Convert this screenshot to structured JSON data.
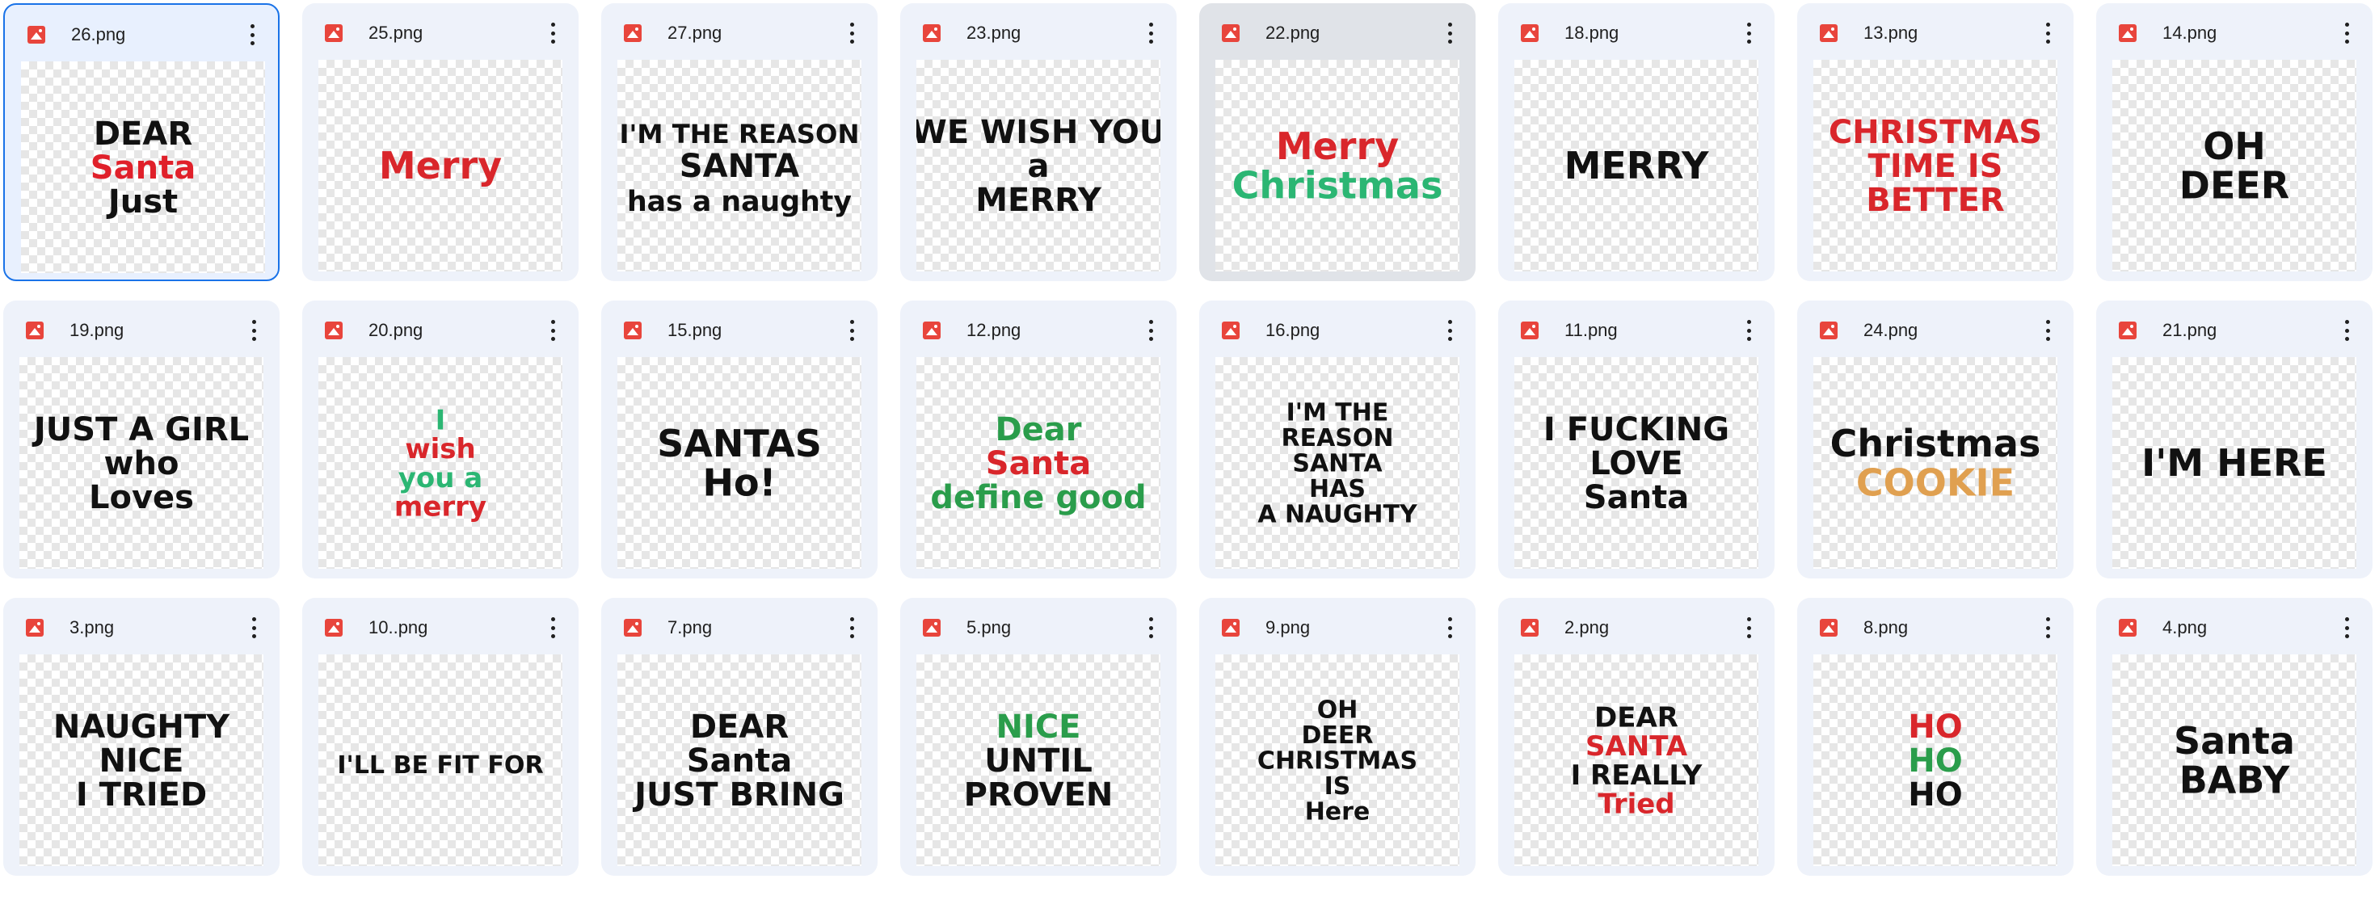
{
  "files": [
    {
      "name": "26.png",
      "selected": true,
      "hovered": false,
      "lines": [
        {
          "t": "DEAR",
          "c": "#111111"
        },
        {
          "t": "Santa",
          "c": "#e0202a"
        },
        {
          "t": "Just",
          "c": "#111111"
        }
      ]
    },
    {
      "name": "25.png",
      "selected": false,
      "hovered": false,
      "lines": [
        {
          "t": "Merry",
          "c": "#d9262b"
        }
      ]
    },
    {
      "name": "27.png",
      "selected": false,
      "hovered": false,
      "lines": [
        {
          "t": "I'M THE REASON",
          "c": "#111111"
        },
        {
          "t": "SANTA",
          "c": "#111111"
        },
        {
          "t": "has a naughty",
          "c": "#111111"
        }
      ]
    },
    {
      "name": "23.png",
      "selected": false,
      "hovered": false,
      "lines": [
        {
          "t": "WE WISH YOU",
          "c": "#111111"
        },
        {
          "t": "a",
          "c": "#111111"
        },
        {
          "t": "MERRY",
          "c": "#111111"
        }
      ]
    },
    {
      "name": "22.png",
      "selected": false,
      "hovered": true,
      "lines": [
        {
          "t": "Merry",
          "c": "#d9262b"
        },
        {
          "t": "Christmas",
          "c": "#2bb673"
        }
      ]
    },
    {
      "name": "18.png",
      "selected": false,
      "hovered": false,
      "lines": [
        {
          "t": "MERRY",
          "c": "#111111"
        }
      ]
    },
    {
      "name": "13.png",
      "selected": false,
      "hovered": false,
      "lines": [
        {
          "t": "CHRISTMAS",
          "c": "#d9262b"
        },
        {
          "t": "TIME IS",
          "c": "#d9262b"
        },
        {
          "t": "BETTER",
          "c": "#d9262b"
        }
      ]
    },
    {
      "name": "14.png",
      "selected": false,
      "hovered": false,
      "lines": [
        {
          "t": "OH",
          "c": "#111111"
        },
        {
          "t": "DEER",
          "c": "#111111"
        }
      ]
    },
    {
      "name": "19.png",
      "selected": false,
      "hovered": false,
      "lines": [
        {
          "t": "JUST A GIRL",
          "c": "#111111"
        },
        {
          "t": "who",
          "c": "#111111"
        },
        {
          "t": "Loves",
          "c": "#111111"
        }
      ]
    },
    {
      "name": "20.png",
      "selected": false,
      "hovered": false,
      "lines": [
        {
          "t": "I",
          "c": "#2bb673"
        },
        {
          "t": "wish",
          "c": "#d9262b"
        },
        {
          "t": "you a",
          "c": "#2bb673"
        },
        {
          "t": "merry",
          "c": "#d9262b"
        }
      ]
    },
    {
      "name": "15.png",
      "selected": false,
      "hovered": false,
      "lines": [
        {
          "t": "SANTAS",
          "c": "#111111"
        },
        {
          "t": "Ho!",
          "c": "#111111"
        }
      ]
    },
    {
      "name": "12.png",
      "selected": false,
      "hovered": false,
      "lines": [
        {
          "t": "Dear",
          "c": "#2a9d4b"
        },
        {
          "t": "Santa",
          "c": "#d9262b"
        },
        {
          "t": "define good",
          "c": "#2a9d4b"
        }
      ]
    },
    {
      "name": "16.png",
      "selected": false,
      "hovered": false,
      "lines": [
        {
          "t": "I'M THE",
          "c": "#111111"
        },
        {
          "t": "REASON",
          "c": "#111111"
        },
        {
          "t": "SANTA",
          "c": "#111111"
        },
        {
          "t": "HAS",
          "c": "#111111"
        },
        {
          "t": "A NAUGHTY",
          "c": "#111111"
        }
      ]
    },
    {
      "name": "11.png",
      "selected": false,
      "hovered": false,
      "lines": [
        {
          "t": "I FUCKING",
          "c": "#111111"
        },
        {
          "t": "LOVE",
          "c": "#111111"
        },
        {
          "t": "Santa",
          "c": "#111111"
        }
      ]
    },
    {
      "name": "24.png",
      "selected": false,
      "hovered": false,
      "lines": [
        {
          "t": "Christmas",
          "c": "#111111"
        },
        {
          "t": "COOKIE",
          "c": "#e0a050"
        }
      ]
    },
    {
      "name": "21.png",
      "selected": false,
      "hovered": false,
      "lines": [
        {
          "t": "I'M HERE",
          "c": "#111111"
        }
      ]
    },
    {
      "name": "3.png",
      "selected": false,
      "hovered": false,
      "lines": [
        {
          "t": "NAUGHTY",
          "c": "#111111"
        },
        {
          "t": "NICE",
          "c": "#111111"
        },
        {
          "t": "I TRIED",
          "c": "#111111"
        }
      ]
    },
    {
      "name": "10..png",
      "selected": false,
      "hovered": false,
      "lines": [
        {
          "t": "I'LL BE FIT FOR",
          "c": "#111111"
        }
      ]
    },
    {
      "name": "7.png",
      "selected": false,
      "hovered": false,
      "lines": [
        {
          "t": "DEAR",
          "c": "#111111"
        },
        {
          "t": "Santa",
          "c": "#111111"
        },
        {
          "t": "JUST BRING",
          "c": "#111111"
        }
      ]
    },
    {
      "name": "5.png",
      "selected": false,
      "hovered": false,
      "lines": [
        {
          "t": "NICE",
          "c": "#2a9d4b"
        },
        {
          "t": "UNTIL",
          "c": "#111111"
        },
        {
          "t": "PROVEN",
          "c": "#111111"
        }
      ]
    },
    {
      "name": "9.png",
      "selected": false,
      "hovered": false,
      "lines": [
        {
          "t": "OH",
          "c": "#111111"
        },
        {
          "t": "DEER",
          "c": "#111111"
        },
        {
          "t": "CHRISTMAS",
          "c": "#111111"
        },
        {
          "t": "IS",
          "c": "#111111"
        },
        {
          "t": "Here",
          "c": "#111111"
        }
      ]
    },
    {
      "name": "2.png",
      "selected": false,
      "hovered": false,
      "lines": [
        {
          "t": "DEAR",
          "c": "#111111"
        },
        {
          "t": "SANTA",
          "c": "#d9262b"
        },
        {
          "t": "I REALLY",
          "c": "#111111"
        },
        {
          "t": "Tried",
          "c": "#d9262b"
        }
      ]
    },
    {
      "name": "8.png",
      "selected": false,
      "hovered": false,
      "lines": [
        {
          "t": "HO",
          "c": "#d9262b"
        },
        {
          "t": "HO",
          "c": "#2a9d4b"
        },
        {
          "t": "HO",
          "c": "#111111"
        }
      ]
    },
    {
      "name": "4.png",
      "selected": false,
      "hovered": false,
      "lines": [
        {
          "t": "Santa",
          "c": "#111111"
        },
        {
          "t": "BABY",
          "c": "#111111"
        }
      ]
    }
  ],
  "icons": {
    "file": "image-file-icon",
    "menu": "more-vert-icon"
  },
  "colors": {
    "selected_border": "#1a73e8",
    "card_bg": "#eef2fa",
    "hover_bg": "#e0e3e8",
    "file_icon": "#e8453c"
  }
}
